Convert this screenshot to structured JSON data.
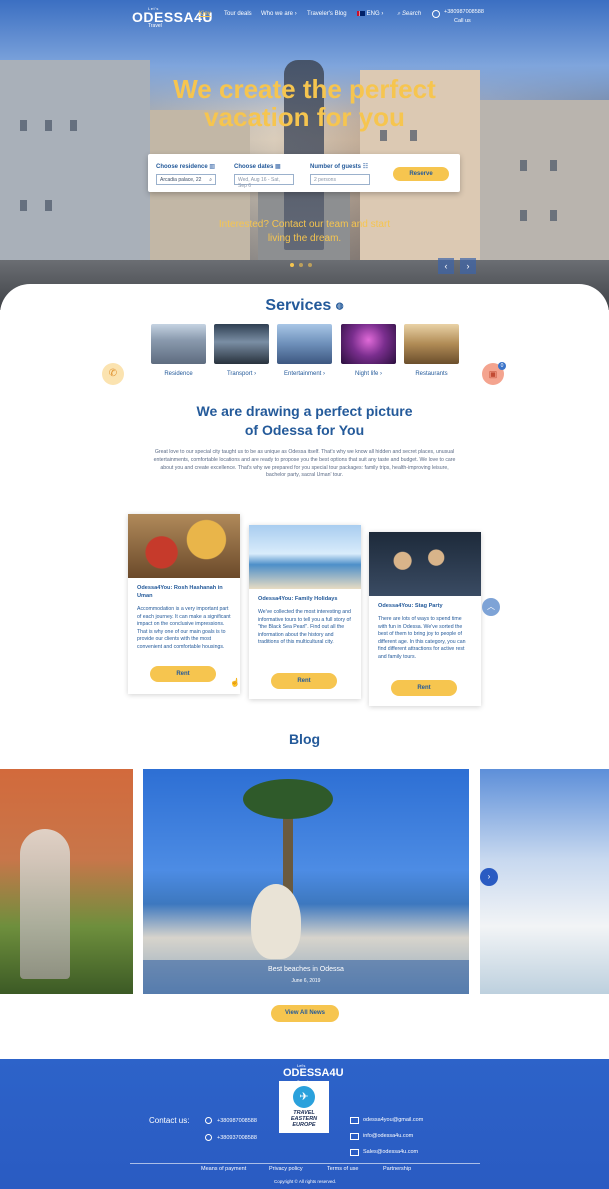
{
  "brand": {
    "top_small": "Let's",
    "name": "ODESSA4U",
    "sub": "Travel"
  },
  "nav": {
    "items": [
      "Kiev",
      "Tour deals",
      "Who we are",
      "Traveler's Blog",
      "ENG"
    ],
    "search": "Search",
    "phone": "+380987008588",
    "call_us": "Call us"
  },
  "hero": {
    "title_line1": "We create the perfect",
    "title_line2": "vacation for you",
    "cta_line1": "Interested? Contact our team and start",
    "cta_line2": "living the dream.",
    "arrow_prev": "‹",
    "arrow_next": "›"
  },
  "booking": {
    "residence_label": "Choose residence",
    "residence_value": "Arcadia palace, 22",
    "dates_label": "Choose dates",
    "dates_placeholder": "Wed, Aug 16 - Sat, Sep 6",
    "guests_label": "Number of guests",
    "guests_placeholder": "2 persons",
    "reserve": "Reserve"
  },
  "services": {
    "title": "Services",
    "items": [
      {
        "label": "Residence",
        "color": "#6f7f92"
      },
      {
        "label": "Transport",
        "color": "#3f5a74"
      },
      {
        "label": "Entertainment",
        "color": "#5b7ea6"
      },
      {
        "label": "Night life",
        "color": "#7a2e8e"
      },
      {
        "label": "Restaurants",
        "color": "#8b6a3a"
      }
    ],
    "cart_count": "0"
  },
  "about": {
    "title_line1": "We are drawing a perfect picture",
    "title_line2": "of Odessa for You",
    "text": "Great love to our special city taught us to be as unique as Odessa itself. That's why we know all hidden and secret places, unusual entertainments, comfortable locations and are ready to propose you the best options that suit any taste and budget. We love to care about you and create excellence. That's why we prepared for you special tour packages: family trips, health-improving leisure, bachelor party, sacral Uman' tour."
  },
  "cards": [
    {
      "title": "Odessa4You: Rosh Hashanah in Uman",
      "text": "Accommodation is a very important part of each journey. It can make a significant impact on the conclusive impressions. That is why one of our main goals is to provide our clients with the most convenient and comfortable housings.",
      "button": "Rent"
    },
    {
      "title": "Odessa4You: Family Holidays",
      "text": "We've collected the most interesting and informative tours to tell you a full story of \"the Black Sea Pearl\". Find out all the information about the history and traditions of this multicultural city.",
      "button": "Rent"
    },
    {
      "title": "Odessa4You: Stag Party",
      "text": "There are lots of ways to spend time with fun in Odessa. We've sorted the best of them to bring joy to people of different age. In this category, you can find different attractions for active rest and family tours.",
      "button": "Rent"
    }
  ],
  "blog": {
    "title": "Blog",
    "post_title": "Best beaches in Odessa",
    "post_date": "June 6, 2019",
    "view_all": "View All News"
  },
  "footer": {
    "contact_label": "Contact us:",
    "phones": [
      "+380987008588",
      "+380937008588"
    ],
    "emails": [
      "odessa4you@gmail.com",
      "info@odessa4u.com",
      "Sales@odessa4u.com"
    ],
    "badge_line1": "TRAVEL",
    "badge_line2": "EASTERN",
    "badge_line3": "EUROPE",
    "links": [
      "Means of payment",
      "Privacy policy",
      "Terms of use",
      "Partnership"
    ],
    "copyright": "Copyright © All rights reserved."
  },
  "colors": {
    "accent": "#f6c54f",
    "brand_blue": "#245a9a",
    "footer_blue": "#2d63c9"
  }
}
